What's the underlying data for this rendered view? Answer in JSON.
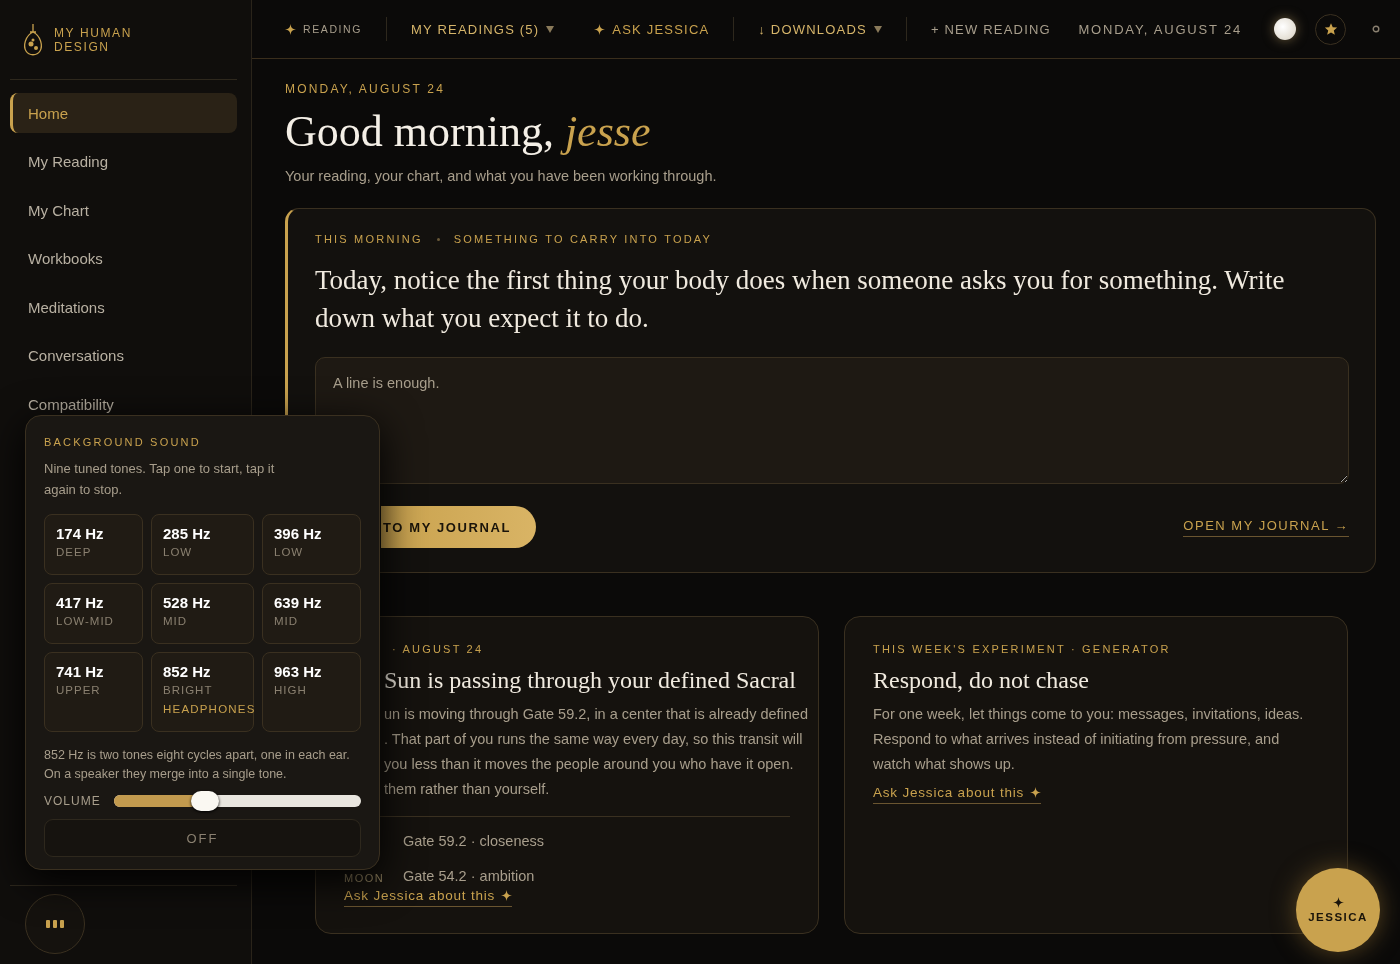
{
  "brand": {
    "name": "MY HUMAN DESIGN"
  },
  "sidebar": {
    "items": [
      {
        "label": "Home",
        "selected": true
      },
      {
        "label": "My Reading",
        "selected": false
      },
      {
        "label": "My Chart",
        "selected": false
      },
      {
        "label": "Workbooks",
        "selected": false
      },
      {
        "label": "Meditations",
        "selected": false
      },
      {
        "label": "Conversations",
        "selected": false
      },
      {
        "label": "Compatibility",
        "selected": false
      }
    ]
  },
  "topbar": {
    "items": [
      {
        "kind": "tag",
        "label": "READING"
      },
      {
        "kind": "menu",
        "label": "MY READINGS (5)"
      },
      {
        "kind": "action",
        "label": "ASK JESSICA"
      },
      {
        "kind": "menu",
        "label": "↓ DOWNLOADS"
      },
      {
        "kind": "plain",
        "label": "+ NEW READING"
      }
    ],
    "date": "MONDAY, AUGUST 24"
  },
  "greeting": {
    "date": "MONDAY, AUGUST 24",
    "title": "Good morning,",
    "name": "jesse",
    "subtitle": "Your reading, your chart, and what you have been working through."
  },
  "prompt_card": {
    "eyebrow": [
      "THIS MORNING",
      "SOMETHING TO CARRY INTO TODAY"
    ],
    "text": "Today, notice the first thing your body does when someone asks you for something. Write down what you expect it to do.",
    "placeholder": "A line is enough.",
    "save_button": "TO MY JOURNAL",
    "link": "OPEN MY JOURNAL →"
  },
  "transit_card": {
    "eyebrow": "· AUGUST 24",
    "title": "Sun is passing through your defined Sacral",
    "body_lines": [
      "un is moving through Gate 59.2, in a center that is already defined",
      ". That part of you runs the same way every day, so this transit will",
      "you less than it moves the people around you who have it open.",
      "them rather than yourself."
    ],
    "transits": [
      {
        "value": "Gate 59.2 · closeness"
      },
      {
        "label": "MOON",
        "value": "Gate 54.2 · ambition"
      }
    ],
    "link": "Ask Jessica about this"
  },
  "experiment_card": {
    "eyebrow": "THIS WEEK'S EXPERIMENT · GENERATOR",
    "title": "Respond, do not chase",
    "body": "For one week, let things come to you: messages, invitations, ideas. Respond to what arrives instead of initiating from pressure, and watch what shows up.",
    "link": "Ask Jessica about this"
  },
  "sound_panel": {
    "title": "BACKGROUND SOUND",
    "description": "Nine tuned tones. Tap one to start, tap it again to stop.",
    "tones": [
      {
        "hz": "174 Hz",
        "range": "DEEP"
      },
      {
        "hz": "285 Hz",
        "range": "LOW"
      },
      {
        "hz": "396 Hz",
        "range": "LOW"
      },
      {
        "hz": "417 Hz",
        "range": "LOW-MID"
      },
      {
        "hz": "528 Hz",
        "range": "MID"
      },
      {
        "hz": "639 Hz",
        "range": "MID"
      },
      {
        "hz": "741 Hz",
        "range": "UPPER"
      },
      {
        "hz": "852 Hz",
        "range": "BRIGHT",
        "note": "HEADPHONES"
      },
      {
        "hz": "963 Hz",
        "range": "HIGH"
      }
    ],
    "note": "852 Hz is two tones eight cycles apart, one in each ear. On a speaker they merge into a single tone.",
    "volume": {
      "label": "VOLUME",
      "level": 0.37
    },
    "off_button": "OFF"
  },
  "jessica_button": {
    "label": "JESSICA"
  }
}
